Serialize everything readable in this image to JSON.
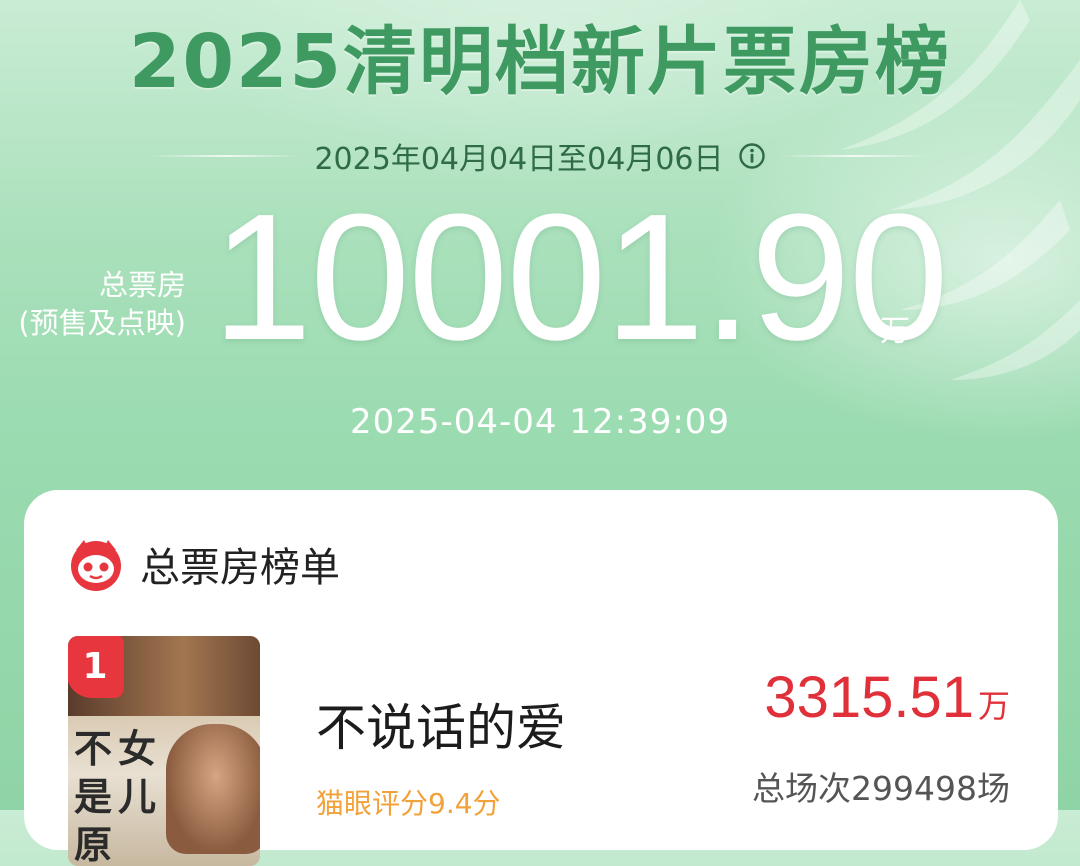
{
  "header": {
    "title": "2025清明档新片票房榜",
    "date_range": "2025年04月04日至04月06日"
  },
  "total": {
    "label_line1": "总票房",
    "label_line2": "(预售及点映)",
    "value": "10001.90",
    "unit": "万",
    "timestamp": "2025-04-04  12:39:09"
  },
  "board": {
    "title": "总票房榜单",
    "movies": [
      {
        "rank": "1",
        "name": "不说话的爱",
        "rating": "猫眼评分9.4分",
        "box_value": "3315.51",
        "box_unit": "万",
        "shows": "总场次299498场",
        "poster_text": [
          "不",
          "女",
          "是",
          "儿",
          "原"
        ]
      }
    ]
  },
  "colors": {
    "title_green": "#3f9a62",
    "accent_red": "#e0303a",
    "rating_orange": "#f2a23a"
  },
  "icons": [
    "info-icon",
    "maoyan-cat-logo-icon"
  ]
}
